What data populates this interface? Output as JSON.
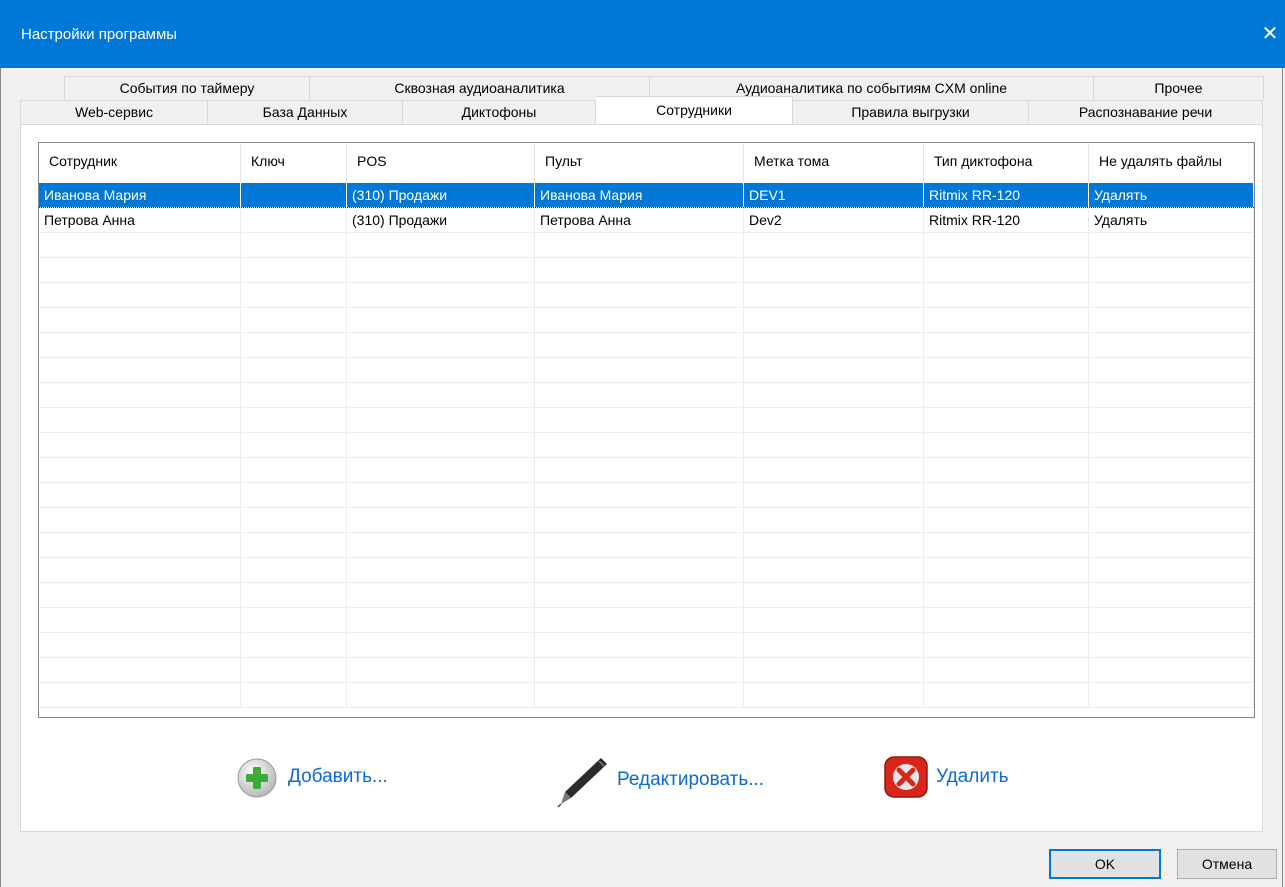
{
  "window": {
    "title": "Настройки программы"
  },
  "tabs": {
    "row1": [
      "События по таймеру",
      "Сквозная аудиоаналитика",
      "Аудиоаналитика по событиям CXM online",
      "Прочее"
    ],
    "row2": [
      "Web-сервис",
      "База Данных",
      "Диктофоны",
      "Сотрудники",
      "Правила выгрузки",
      "Распознавание речи"
    ],
    "active": "Сотрудники"
  },
  "table": {
    "columns": [
      "Сотрудник",
      "Ключ",
      "POS",
      "Пульт",
      "Метка тома",
      "Тип диктофона",
      "Не удалять файлы"
    ],
    "rows": [
      [
        "Иванова Мария",
        "",
        "(310) Продажи",
        "Иванова Мария",
        "DEV1",
        "Ritmix RR-120",
        "Удалять"
      ],
      [
        "Петрова Анна",
        "",
        "(310) Продажи",
        "Петрова Анна",
        "Dev2",
        "Ritmix RR-120",
        "Удалять"
      ]
    ],
    "selected_row": 0
  },
  "actions": {
    "add": "Добавить...",
    "edit": "Редактировать...",
    "delete": "Удалить"
  },
  "buttons": {
    "ok": "OK",
    "cancel": "Отмена"
  },
  "colors": {
    "accent": "#0078d7",
    "link": "#0a6ad2",
    "delete": "#d9261c",
    "add": "#3cab3a"
  }
}
